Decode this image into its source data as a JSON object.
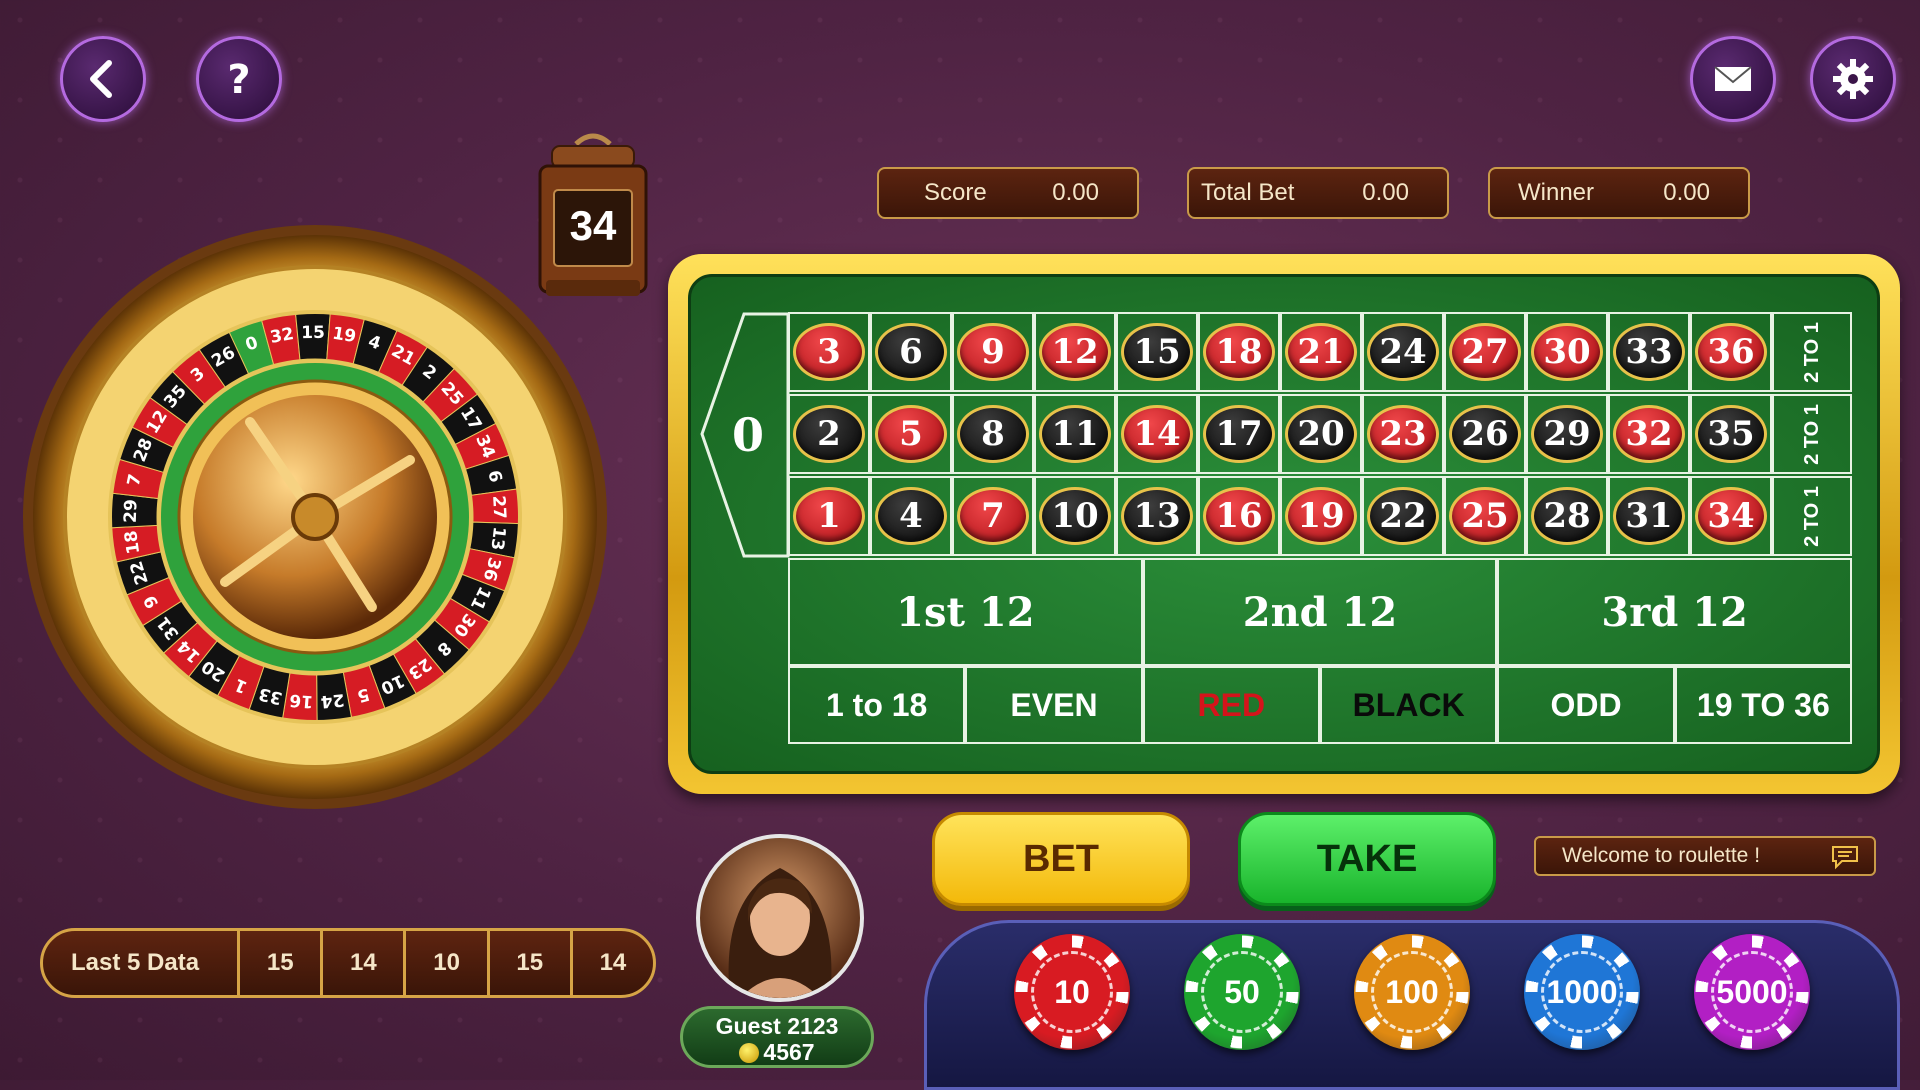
{
  "top_bar": {
    "back_icon": "back-icon",
    "help_icon": "help-icon",
    "mail_icon": "mail-icon",
    "settings_icon": "gear-icon"
  },
  "stats": {
    "score_label": "Score",
    "score_value": "0.00",
    "total_bet_label": "Total Bet",
    "total_bet_value": "0.00",
    "winner_label": "Winner",
    "winner_value": "0.00"
  },
  "timer": {
    "value": "34"
  },
  "table": {
    "zero": "0",
    "rows": [
      [
        [
          "3",
          "red"
        ],
        [
          "6",
          "black"
        ],
        [
          "9",
          "red"
        ],
        [
          "12",
          "red"
        ],
        [
          "15",
          "black"
        ],
        [
          "18",
          "red"
        ],
        [
          "21",
          "red"
        ],
        [
          "24",
          "black"
        ],
        [
          "27",
          "red"
        ],
        [
          "30",
          "red"
        ],
        [
          "33",
          "black"
        ],
        [
          "36",
          "red"
        ]
      ],
      [
        [
          "2",
          "black"
        ],
        [
          "5",
          "red"
        ],
        [
          "8",
          "black"
        ],
        [
          "11",
          "black"
        ],
        [
          "14",
          "red"
        ],
        [
          "17",
          "black"
        ],
        [
          "20",
          "black"
        ],
        [
          "23",
          "red"
        ],
        [
          "26",
          "black"
        ],
        [
          "29",
          "black"
        ],
        [
          "32",
          "red"
        ],
        [
          "35",
          "black"
        ]
      ],
      [
        [
          "1",
          "red"
        ],
        [
          "4",
          "black"
        ],
        [
          "7",
          "red"
        ],
        [
          "10",
          "black"
        ],
        [
          "13",
          "black"
        ],
        [
          "16",
          "red"
        ],
        [
          "19",
          "red"
        ],
        [
          "22",
          "black"
        ],
        [
          "25",
          "red"
        ],
        [
          "28",
          "black"
        ],
        [
          "31",
          "black"
        ],
        [
          "34",
          "red"
        ]
      ]
    ],
    "columns": [
      "2 TO 1",
      "2 TO 1",
      "2 TO 1"
    ],
    "dozens": [
      "1st 12",
      "2nd 12",
      "3rd 12"
    ],
    "outside": [
      "1 to 18",
      "EVEN",
      "RED",
      "BLACK",
      "ODD",
      "19 TO 36"
    ]
  },
  "wheel": {
    "numbers": [
      "0",
      "32",
      "15",
      "19",
      "4",
      "21",
      "2",
      "25",
      "17",
      "34",
      "6",
      "27",
      "13",
      "36",
      "11",
      "30",
      "8",
      "23",
      "10",
      "5",
      "24",
      "16",
      "33",
      "1",
      "20",
      "14",
      "31",
      "9",
      "22",
      "18",
      "29",
      "7",
      "28",
      "12",
      "35",
      "3",
      "26"
    ]
  },
  "last5": {
    "label": "Last 5 Data",
    "values": [
      "15",
      "14",
      "10",
      "15",
      "14"
    ]
  },
  "player": {
    "name": "Guest 2123",
    "coins": "4567"
  },
  "buttons": {
    "bet": "BET",
    "take": "TAKE"
  },
  "message": {
    "text": "Welcome to roulette !"
  },
  "chips": [
    {
      "value": "10",
      "color": "#d81b22"
    },
    {
      "value": "50",
      "color": "#1ea52e"
    },
    {
      "value": "100",
      "color": "#e08a12"
    },
    {
      "value": "1000",
      "color": "#1f76d6"
    },
    {
      "value": "5000",
      "color": "#b21fc4"
    }
  ],
  "colors": {
    "felt": "#1f7a2c",
    "gold": "#f3c531",
    "red": "#c4101a",
    "black": "#0a0a0a"
  }
}
